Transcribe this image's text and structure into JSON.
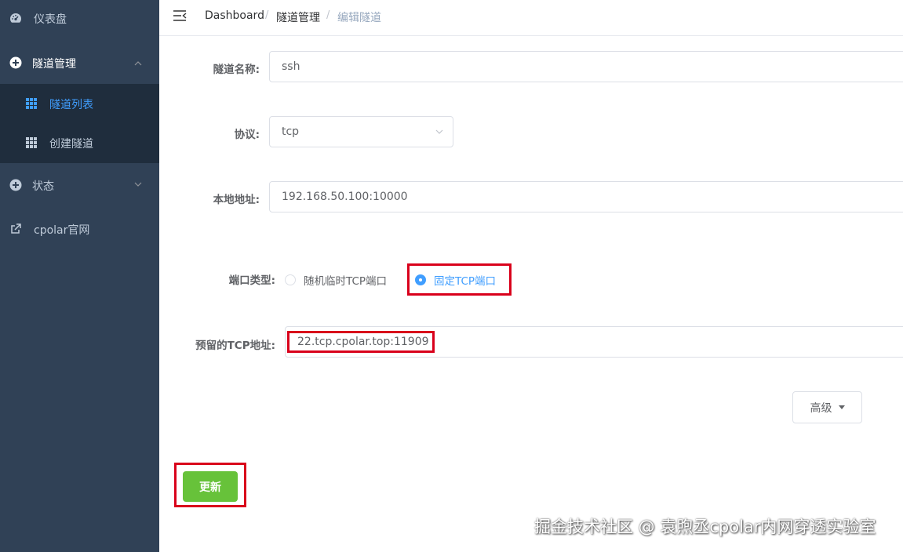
{
  "sidebar": {
    "dashboard": {
      "label": "仪表盘",
      "icon": "dashboard-icon"
    },
    "tunnel_mgmt": {
      "label": "隧道管理",
      "icon": "circle-plus-icon"
    },
    "tunnel_list": {
      "label": "隧道列表",
      "icon": "grid-icon"
    },
    "create_tunnel": {
      "label": "创建隧道",
      "icon": "grid-icon"
    },
    "status": {
      "label": "状态",
      "icon": "circle-plus-icon"
    },
    "website": {
      "label": "cpolar官网",
      "icon": "external-link-icon"
    }
  },
  "breadcrumb": {
    "items": [
      "Dashboard",
      "隧道管理",
      "编辑隧道"
    ],
    "separator": "/"
  },
  "form": {
    "name": {
      "label": "隧道名称:",
      "value": "ssh"
    },
    "protocol": {
      "label": "协议:",
      "value": "tcp"
    },
    "local_addr": {
      "label": "本地地址:",
      "value": "192.168.50.100:10000"
    },
    "port_type": {
      "label": "端口类型:",
      "options": [
        "随机临时TCP端口",
        "固定TCP端口"
      ],
      "selected": "固定TCP端口"
    },
    "reserved_tcp": {
      "label": "预留的TCP地址:",
      "value": "22.tcp.cpolar.top:11909"
    }
  },
  "buttons": {
    "advanced": "高级",
    "update": "更新"
  },
  "watermark": "掘金技术社区 @ 袁煦丞cpolar内网穿透实验室",
  "colors": {
    "sidebar_bg": "#304156",
    "submenu_bg": "#1f2d3d",
    "accent": "#409eff",
    "success": "#67c23a",
    "highlight_box": "#d9001b"
  }
}
